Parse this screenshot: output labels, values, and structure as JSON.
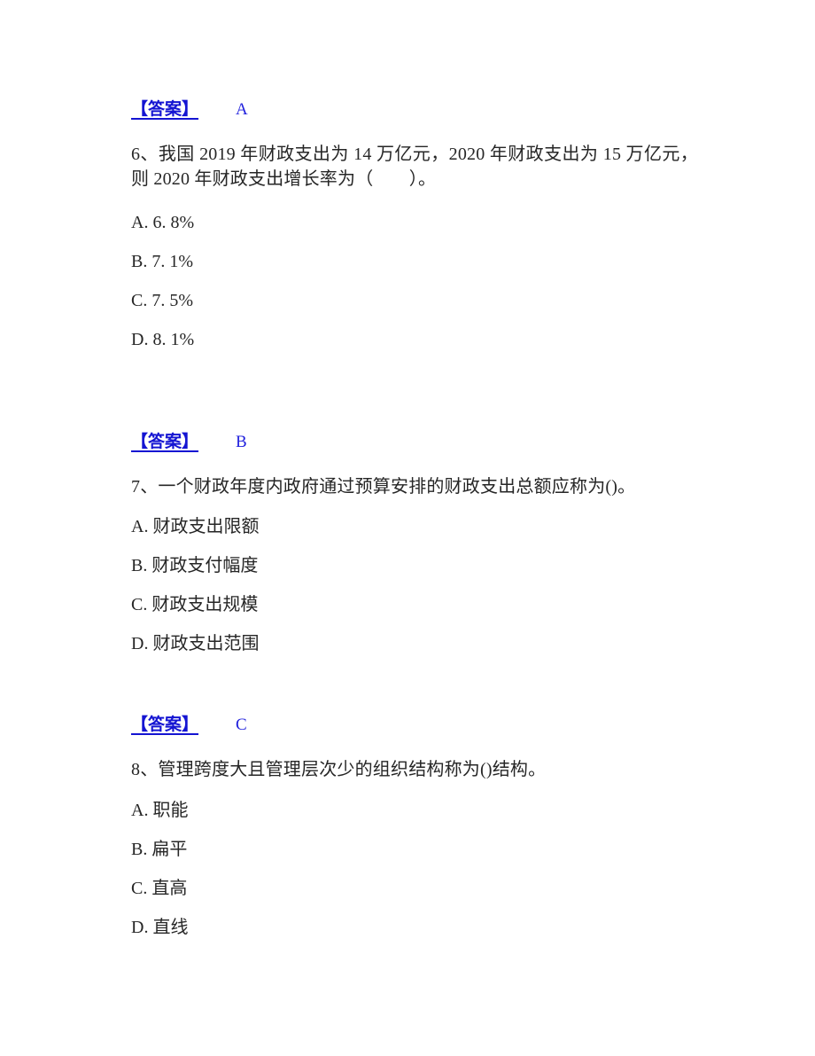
{
  "document": {
    "type": "exam-answer-sheet",
    "accent_color": "#1414d2",
    "text_color": "#262626",
    "background": "#ffffff"
  },
  "blocks": [
    {
      "answer": {
        "label": "【答案】",
        "value": "A"
      },
      "question": null,
      "options": []
    },
    {
      "answer": null,
      "question": {
        "number": "6、",
        "text": "我国 2019 年财政支出为 14 万亿元，2020 年财政支出为 15 万亿元，则 2020 年财政支出增长率为（　　）。"
      },
      "options": [
        "A. 6. 8%",
        "B. 7. 1%",
        "C. 7. 5%",
        "D. 8. 1%"
      ]
    },
    {
      "answer": {
        "label": "【答案】",
        "value": "B"
      },
      "question": {
        "number": "7、",
        "text": "一个财政年度内政府通过预算安排的财政支出总额应称为()。"
      },
      "options": [
        "A. 财政支出限额",
        "B. 财政支付幅度",
        "C. 财政支出规模",
        "D. 财政支出范围"
      ]
    },
    {
      "answer": {
        "label": "【答案】",
        "value": "C"
      },
      "question": {
        "number": "8、",
        "text": "管理跨度大且管理层次少的组织结构称为()结构。"
      },
      "options": [
        "A. 职能",
        "B. 扁平",
        "C. 直高",
        "D. 直线"
      ]
    }
  ]
}
